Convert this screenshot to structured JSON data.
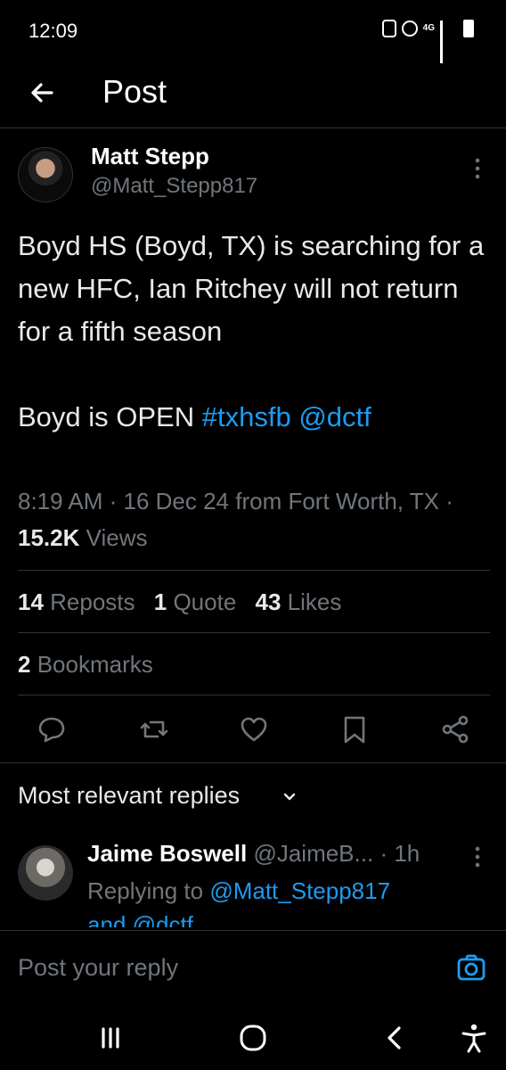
{
  "status_bar": {
    "time": "12:09",
    "network": "4G"
  },
  "header": {
    "title": "Post"
  },
  "tweet": {
    "author_name": "Matt Stepp",
    "author_handle": "@Matt_Stepp817",
    "text": "Boyd HS (Boyd, TX) is searching for a new HFC, Ian Ritchey will not return for a fifth season",
    "text2": "Boyd is OPEN ",
    "hashtag": "#txhsfb",
    "mention": "@dctf",
    "timestamp": "8:19 AM · 16 Dec 24 from Fort Worth, TX · ",
    "views_count": "15.2K",
    "views_label": " Views"
  },
  "stats": {
    "reposts_count": "14",
    "reposts_label": " Reposts",
    "quotes_count": "1",
    "quotes_label": " Quote",
    "likes_count": "43",
    "likes_label": " Likes",
    "bookmarks_count": "2",
    "bookmarks_label": " Bookmarks"
  },
  "replies_section": {
    "label": "Most relevant replies"
  },
  "reply": {
    "author_name": "Jaime Boswell",
    "author_handle": "@JaimeB...",
    "time": "· 1h",
    "replying_prefix": "Replying to ",
    "replying_to": "@Matt_Stepp817",
    "and_text": " and @dctf"
  },
  "composer": {
    "placeholder": "Post your reply"
  },
  "colors": {
    "accent": "#1d9bf0",
    "background": "#000000",
    "muted": "#71767b"
  }
}
